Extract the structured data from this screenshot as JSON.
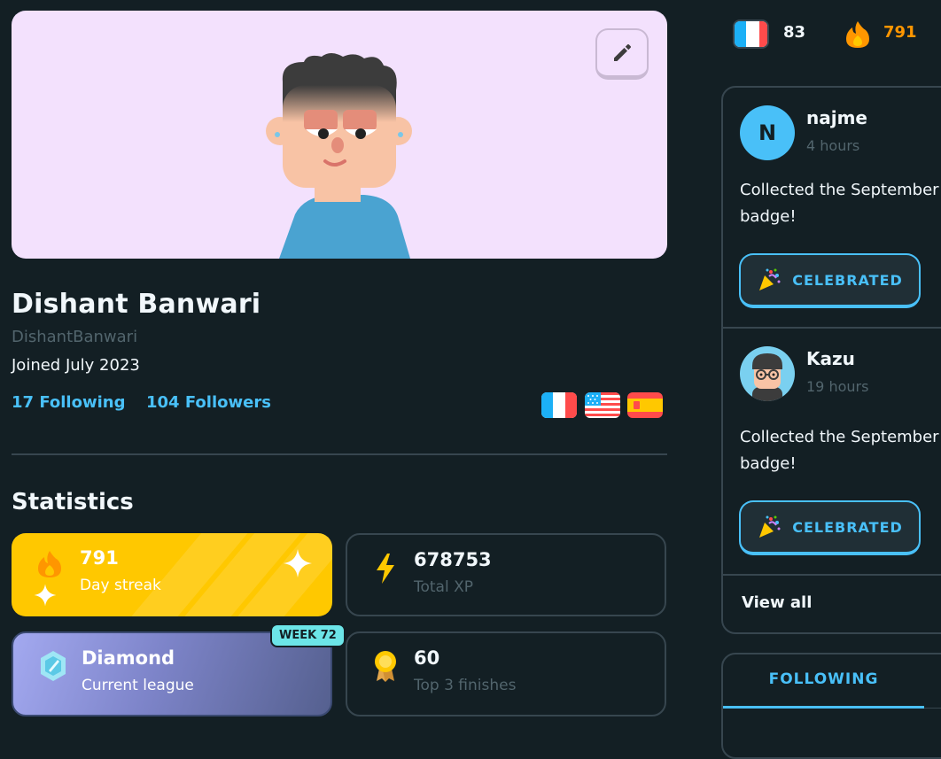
{
  "profile": {
    "display_name": "Dishant Banwari",
    "username": "DishantBanwari",
    "joined": "Joined July 2023",
    "following": "17 Following",
    "followers": "104 Followers",
    "courses": [
      {
        "icon": "flag-france-icon"
      },
      {
        "icon": "flag-usa-icon"
      },
      {
        "icon": "flag-spain-icon"
      }
    ]
  },
  "statistics": {
    "title": "Statistics",
    "streak": {
      "value": "791",
      "label": "Day streak"
    },
    "xp": {
      "value": "678753",
      "label": "Total XP"
    },
    "league": {
      "value": "Diamond",
      "label": "Current league",
      "badge": "WEEK 72"
    },
    "top3": {
      "value": "60",
      "label": "Top 3 finishes"
    }
  },
  "top_bar": {
    "course_count": "83",
    "streak_count": "791"
  },
  "feed": {
    "items": [
      {
        "avatar_letter": "N",
        "name": "najme",
        "time": "4 hours",
        "text": "Collected the September badge!",
        "button": "CELEBRATED"
      },
      {
        "avatar_letter": "",
        "name": "Kazu",
        "time": "19 hours",
        "text": "Collected the September badge!",
        "button": "CELEBRATED"
      }
    ],
    "view_all": "View all"
  },
  "friends": {
    "tab_label": "FOLLOWING"
  },
  "colors": {
    "background": "#131f24",
    "accent_blue": "#49c0f8",
    "streak_orange": "#ff9600",
    "streak_yellow": "#ffc800",
    "muted": "#52656d",
    "border": "#37464f"
  }
}
